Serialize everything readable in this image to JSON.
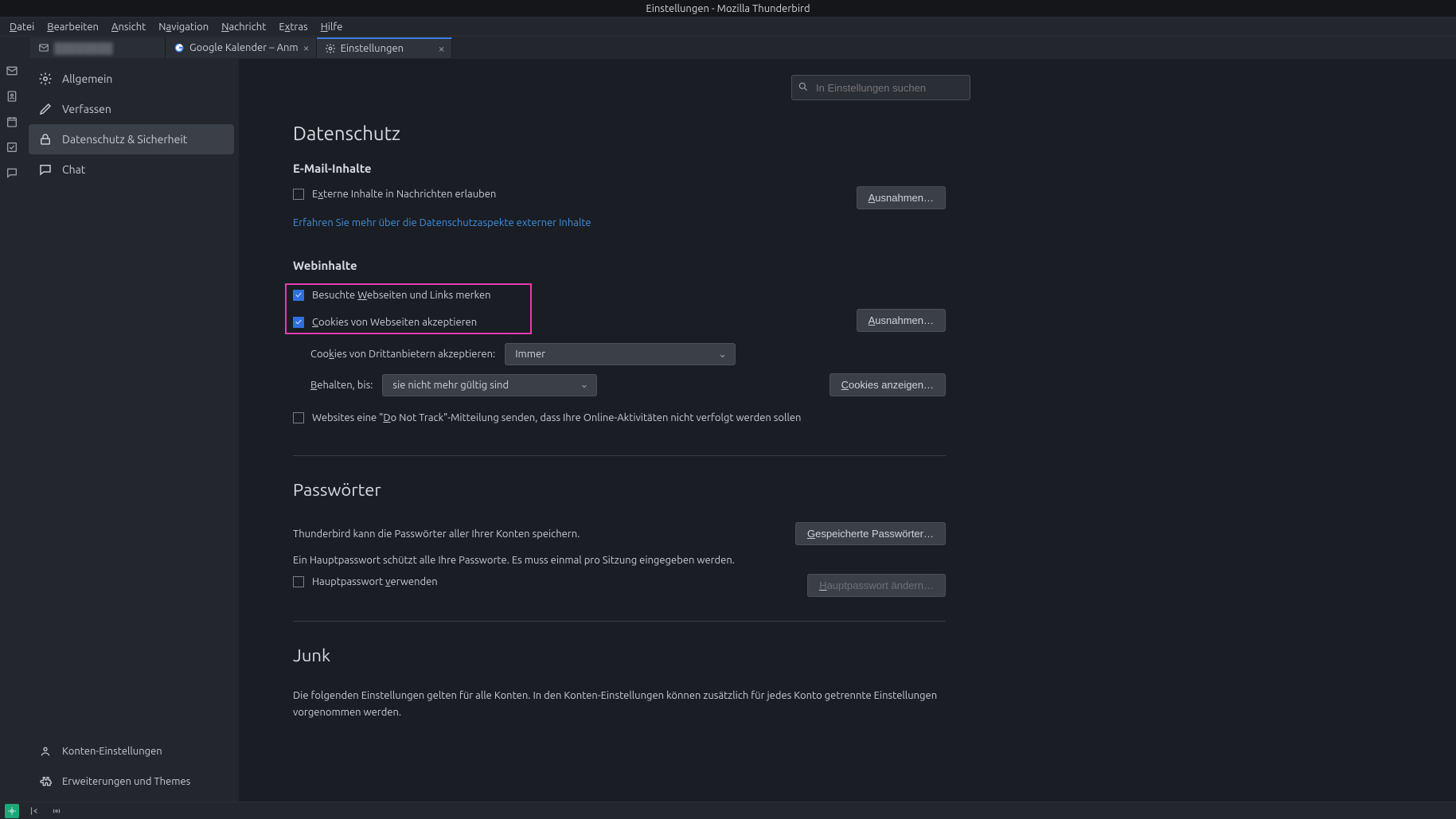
{
  "window_title": "Einstellungen - Mozilla Thunderbird",
  "menubar": [
    "Datei",
    "Bearbeiten",
    "Ansicht",
    "Navigation",
    "Nachricht",
    "Extras",
    "Hilfe"
  ],
  "tabs": [
    {
      "label": ""
    },
    {
      "label": "Google Kalender – Anm"
    },
    {
      "label": "Einstellungen"
    }
  ],
  "sidebar": {
    "items": [
      {
        "label": "Allgemein"
      },
      {
        "label": "Verfassen"
      },
      {
        "label": "Datenschutz & Sicherheit"
      },
      {
        "label": "Chat"
      }
    ],
    "bottom": [
      {
        "label": "Konten-Einstellungen"
      },
      {
        "label": "Erweiterungen und Themes"
      }
    ]
  },
  "search": {
    "placeholder": "In Einstellungen suchen"
  },
  "privacy": {
    "heading": "Datenschutz",
    "email_section": "E-Mail-Inhalte",
    "allow_remote": "Externe Inhalte in Nachrichten erlauben",
    "exceptions_btn": "Ausnahmen…",
    "learn_more": "Erfahren Sie mehr über die Datenschutzaspekte externer Inhalte",
    "web_section": "Webinhalte",
    "remember_visited": "Besuchte Webseiten und Links merken",
    "accept_cookies": "Cookies von Webseiten akzeptieren",
    "third_party_label": "Cookies von Drittanbietern akzeptieren:",
    "third_party_value": "Immer",
    "keep_until_label": "Behalten, bis:",
    "keep_until_value": "sie nicht mehr gültig sind",
    "show_cookies_btn": "Cookies anzeigen…",
    "dnt": "Websites eine \"Do Not Track\"-Mitteilung senden, dass Ihre Online-Aktivitäten nicht verfolgt werden sollen"
  },
  "passwords": {
    "heading": "Passwörter",
    "desc1": "Thunderbird kann die Passwörter aller Ihrer Konten speichern.",
    "saved_btn": "Gespeicherte Passwörter…",
    "desc2": "Ein Hauptpasswort schützt alle Ihre Passworte. Es muss einmal pro Sitzung eingegeben werden.",
    "use_master": "Hauptpasswort verwenden",
    "change_master_btn": "Hauptpasswort ändern…"
  },
  "junk": {
    "heading": "Junk",
    "desc": "Die folgenden Einstellungen gelten für alle Konten. In den Konten-Einstellungen können zusätzlich für jedes Konto getrennte Einstellungen vorgenommen werden."
  }
}
